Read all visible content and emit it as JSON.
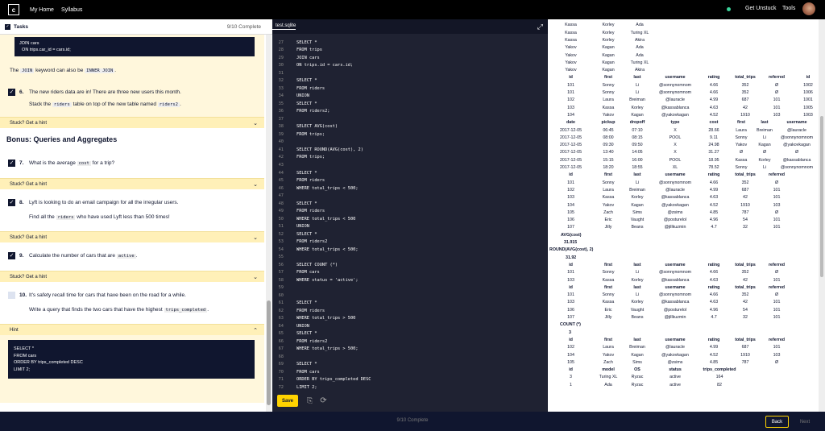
{
  "nav": {
    "home": "My Home",
    "syllabus": "Syllabus",
    "get_unstuck": "Get Unstuck",
    "tools": "Tools"
  },
  "tasks": {
    "title": "Tasks",
    "progress": "9/10 Complete"
  },
  "lesson": {
    "top_code": "JOIN cars\n  ON trips.car_id = cars.id;",
    "join_note_pre": "The ",
    "join_kw": "JOIN",
    "join_note_mid": " keyword can also be ",
    "inner_kw": "INNER JOIN",
    "join_note_post": ".",
    "t6_num": "6.",
    "t6_text": "The new riders data are in! There are three new users this month.",
    "t6_sub_pre": "Stack the ",
    "t6_sub_code1": "riders",
    "t6_sub_mid": " table on top of the new table named ",
    "t6_sub_code2": "riders2",
    "t6_sub_post": ".",
    "hint_label": "Stuck? Get a hint",
    "bonus": "Bonus: Queries and Aggregates",
    "t7_num": "7.",
    "t7_pre": "What is the average ",
    "t7_code": "cost",
    "t7_post": " for a trip?",
    "t8_num": "8.",
    "t8_text": "Lyft is looking to do an email campaign for all the irregular users.",
    "t8_sub_pre": "Find all the ",
    "t8_sub_code": "riders",
    "t8_sub_post": " who have used Lyft less than 500 times!",
    "t9_num": "9.",
    "t9_pre": "Calculate the number of cars that are ",
    "t9_code": "active",
    "t9_post": ".",
    "t10_num": "10.",
    "t10_text": "It's safety recall time for cars that have been on the road for a while.",
    "t10_sub_pre": "Write a query that finds the two cars that have the highest ",
    "t10_sub_code": "trips_completed",
    "t10_sub_post": ".",
    "hint_open": "Hint",
    "hint_code": "SELECT *\nFROM cars\nORDER BY trips_completed DESC\nLIMIT 2;"
  },
  "editor": {
    "tab": "test.sqlite",
    "save": "Save",
    "lines": [
      {
        "n": "27",
        "t": "SELECT *"
      },
      {
        "n": "28",
        "t": "FROM trips"
      },
      {
        "n": "29",
        "t": "JOIN cars"
      },
      {
        "n": "30",
        "t": "ON trips.id = cars.id;"
      },
      {
        "n": "31",
        "t": ""
      },
      {
        "n": "32",
        "t": "SELECT *"
      },
      {
        "n": "33",
        "t": "FROM riders"
      },
      {
        "n": "34",
        "t": "UNION"
      },
      {
        "n": "35",
        "t": "SELECT *"
      },
      {
        "n": "36",
        "t": "FROM riders2;"
      },
      {
        "n": "37",
        "t": ""
      },
      {
        "n": "38",
        "t": "SELECT AVG(cost)"
      },
      {
        "n": "39",
        "t": "FROM trips;"
      },
      {
        "n": "40",
        "t": ""
      },
      {
        "n": "41",
        "t": "SELECT ROUND(AVG(cost), 2)"
      },
      {
        "n": "42",
        "t": "FROM trips;"
      },
      {
        "n": "43",
        "t": ""
      },
      {
        "n": "44",
        "t": "SELECT *"
      },
      {
        "n": "45",
        "t": "FROM riders"
      },
      {
        "n": "46",
        "t": "WHERE total_trips < 500;"
      },
      {
        "n": "47",
        "t": ""
      },
      {
        "n": "48",
        "t": "SELECT *"
      },
      {
        "n": "49",
        "t": "FROM riders"
      },
      {
        "n": "50",
        "t": "WHERE total_trips < 500"
      },
      {
        "n": "51",
        "t": "UNION"
      },
      {
        "n": "52",
        "t": "SELECT *"
      },
      {
        "n": "53",
        "t": "FROM riders2"
      },
      {
        "n": "54",
        "t": "WHERE total_trips < 500;"
      },
      {
        "n": "55",
        "t": ""
      },
      {
        "n": "56",
        "t": "SELECT COUNT (*)"
      },
      {
        "n": "57",
        "t": "FROM cars"
      },
      {
        "n": "58",
        "t": "WHERE status = 'active';"
      },
      {
        "n": "59",
        "t": ""
      },
      {
        "n": "60",
        "t": ""
      },
      {
        "n": "61",
        "t": "SELECT *"
      },
      {
        "n": "62",
        "t": "FROM riders"
      },
      {
        "n": "63",
        "t": "WHERE total_trips > 500"
      },
      {
        "n": "64",
        "t": "UNION"
      },
      {
        "n": "65",
        "t": "SELECT *"
      },
      {
        "n": "66",
        "t": "FROM riders2"
      },
      {
        "n": "67",
        "t": "WHERE total_trips > 500;"
      },
      {
        "n": "68",
        "t": ""
      },
      {
        "n": "69",
        "t": "SELECT *"
      },
      {
        "n": "70",
        "t": "FROM cars"
      },
      {
        "n": "71",
        "t": "ORDER BY trips_completed DESC"
      },
      {
        "n": "72",
        "t": "LIMIT 2;"
      }
    ]
  },
  "results": {
    "top_rows": [
      [
        "Kassa",
        "Korley",
        "Ada"
      ],
      [
        "Kassa",
        "Korley",
        "Ada"
      ],
      [
        "Kassa",
        "Korley",
        "Turing XL"
      ],
      [
        "Kassa",
        "Korley",
        "Akira"
      ],
      [
        "Yakov",
        "Kagan",
        "Ada"
      ],
      [
        "Yakov",
        "Kagan",
        "Ada"
      ],
      [
        "Yakov",
        "Kagan",
        "Turing XL"
      ],
      [
        "Yakov",
        "Kagan",
        "Akira"
      ]
    ],
    "join_headers": [
      "id",
      "first",
      "last",
      "username",
      "rating",
      "total_trips",
      "referred",
      "id",
      "date"
    ],
    "join_rows": [
      [
        "101",
        "Sonny",
        "Li",
        "@sonnynomnom",
        "4.66",
        "352",
        "Ø",
        "1002",
        "2017-12"
      ],
      [
        "101",
        "Sonny",
        "Li",
        "@sonnynomnom",
        "4.66",
        "352",
        "Ø",
        "1006",
        "2017-12"
      ],
      [
        "102",
        "Laura",
        "Breiman",
        "@lauracle",
        "4.99",
        "687",
        "101",
        "1001",
        "2017-12"
      ],
      [
        "103",
        "Kassa",
        "Korley",
        "@kassablanca",
        "4.63",
        "42",
        "101",
        "1005",
        "2017-12"
      ],
      [
        "104",
        "Yakov",
        "Kagan",
        "@yakovkagan",
        "4.52",
        "1910",
        "103",
        "1003",
        "2017-12"
      ]
    ],
    "trip_headers": [
      "date",
      "pickup",
      "dropoff",
      "type",
      "cost",
      "first",
      "last",
      "username"
    ],
    "trip_rows": [
      [
        "2017-12-05",
        "06:45",
        "07:10",
        "X",
        "28.66",
        "Laura",
        "Breiman",
        "@lauracle"
      ],
      [
        "2017-12-05",
        "08:00",
        "08:15",
        "POOL",
        "9.11",
        "Sonny",
        "Li",
        "@sonnynomnom"
      ],
      [
        "2017-12-05",
        "09:30",
        "09:50",
        "X",
        "24.98",
        "Yakov",
        "Kagan",
        "@yakovkagan"
      ],
      [
        "2017-12-05",
        "13:40",
        "14:05",
        "X",
        "31.27",
        "Ø",
        "Ø",
        "Ø"
      ],
      [
        "2017-12-05",
        "15:15",
        "16:00",
        "POOL",
        "18.95",
        "Kassa",
        "Korley",
        "@kassablanca"
      ],
      [
        "2017-12-05",
        "18:20",
        "18:55",
        "XL",
        "78.52",
        "Sonny",
        "Li",
        "@sonnynomnom"
      ]
    ],
    "union_headers": [
      "id",
      "first",
      "last",
      "username",
      "rating",
      "total_trips",
      "referred"
    ],
    "union_rows": [
      [
        "101",
        "Sonny",
        "Li",
        "@sonnynomnom",
        "4.66",
        "352",
        "Ø"
      ],
      [
        "102",
        "Laura",
        "Breiman",
        "@lauracle",
        "4.99",
        "687",
        "101"
      ],
      [
        "103",
        "Kassa",
        "Korley",
        "@kassablanca",
        "4.63",
        "42",
        "101"
      ],
      [
        "104",
        "Yakov",
        "Kagan",
        "@yakovkagan",
        "4.52",
        "1910",
        "103"
      ],
      [
        "105",
        "Zach",
        "Sims",
        "@zsims",
        "4.85",
        "787",
        "Ø"
      ],
      [
        "106",
        "Eric",
        "Vaught",
        "@posturelol",
        "4.96",
        "54",
        "101"
      ],
      [
        "107",
        "Jilly",
        "Beans",
        "@jillkuzmin",
        "4.7",
        "32",
        "101"
      ]
    ],
    "avg_label": "AVG(cost)",
    "avg_value": "31.915",
    "round_label": "ROUND(AVG(cost), 2)",
    "round_value": "31.92",
    "lt500_headers": [
      "id",
      "first",
      "last",
      "username",
      "rating",
      "total_trips",
      "referred"
    ],
    "lt500_rows": [
      [
        "101",
        "Sonny",
        "Li",
        "@sonnynomnom",
        "4.66",
        "352",
        "Ø"
      ],
      [
        "103",
        "Kassa",
        "Korley",
        "@kassablanca",
        "4.63",
        "42",
        "101"
      ]
    ],
    "lt500u_headers": [
      "id",
      "first",
      "last",
      "username",
      "rating",
      "total_trips",
      "referred"
    ],
    "lt500u_rows": [
      [
        "101",
        "Sonny",
        "Li",
        "@sonnynomnom",
        "4.66",
        "352",
        "Ø"
      ],
      [
        "103",
        "Kassa",
        "Korley",
        "@kassablanca",
        "4.63",
        "42",
        "101"
      ],
      [
        "106",
        "Eric",
        "Vaught",
        "@posturelol",
        "4.96",
        "54",
        "101"
      ],
      [
        "107",
        "Jilly",
        "Beans",
        "@jillkuzmin",
        "4.7",
        "32",
        "101"
      ]
    ],
    "count_label": "COUNT (*)",
    "count_value": "3",
    "gt500_headers": [
      "id",
      "first",
      "last",
      "username",
      "rating",
      "total_trips",
      "referred"
    ],
    "gt500_rows": [
      [
        "102",
        "Laura",
        "Breiman",
        "@lauracle",
        "4.99",
        "687",
        "101"
      ],
      [
        "104",
        "Yakov",
        "Kagan",
        "@yakovkagan",
        "4.52",
        "1910",
        "103"
      ],
      [
        "105",
        "Zach",
        "Sims",
        "@zsims",
        "4.85",
        "787",
        "Ø"
      ]
    ],
    "cars_headers": [
      "id",
      "model",
      "OS",
      "status",
      "trips_completed"
    ],
    "cars_rows": [
      [
        "3",
        "Turing XL",
        "Ryzac",
        "active",
        "164"
      ],
      [
        "1",
        "Ada",
        "Ryzac",
        "active",
        "82"
      ]
    ]
  },
  "footer": {
    "progress": "9/10 Complete",
    "back": "Back",
    "next": "Next"
  }
}
